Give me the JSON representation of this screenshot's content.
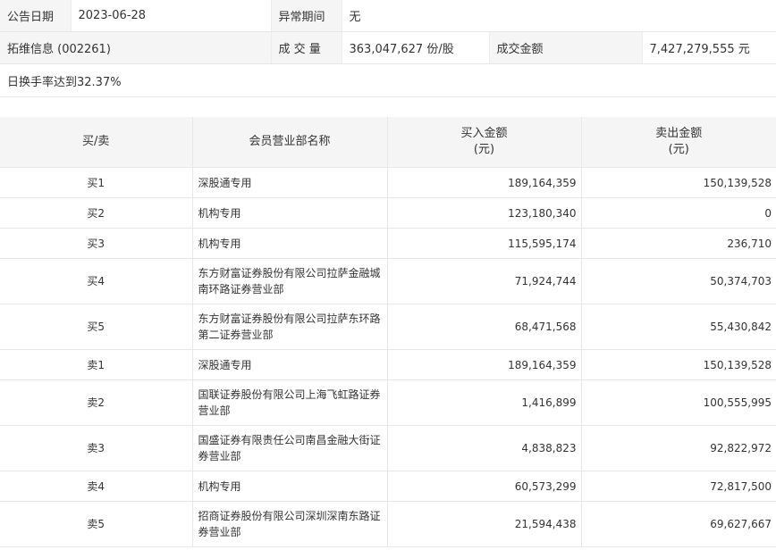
{
  "info": {
    "announce_date_label": "公告日期",
    "announce_date": "2023-06-28",
    "abnormal_period_label": "异常期间",
    "abnormal_period": "无",
    "stock": "拓维信息 (002261)",
    "volume_label": "成 交 量",
    "volume": "363,047,627 份/股",
    "amount_label": "成交金额",
    "amount": "7,427,279,555 元",
    "reason": "日换手率达到32.37%"
  },
  "table": {
    "headers": {
      "side": "买/卖",
      "dept": "会员营业部名称",
      "buy_line1": "买入金额",
      "buy_line2": "(元)",
      "sell_line1": "卖出金额",
      "sell_line2": "(元)"
    },
    "rows": [
      {
        "side": "买1",
        "name": "深股通专用",
        "buy": "189,164,359",
        "sell": "150,139,528"
      },
      {
        "side": "买2",
        "name": "机构专用",
        "buy": "123,180,340",
        "sell": "0"
      },
      {
        "side": "买3",
        "name": "机构专用",
        "buy": "115,595,174",
        "sell": "236,710"
      },
      {
        "side": "买4",
        "name": "东方财富证券股份有限公司拉萨金融城南环路证券营业部",
        "buy": "71,924,744",
        "sell": "50,374,703"
      },
      {
        "side": "买5",
        "name": "东方财富证券股份有限公司拉萨东环路第二证券营业部",
        "buy": "68,471,568",
        "sell": "55,430,842"
      },
      {
        "side": "卖1",
        "name": "深股通专用",
        "buy": "189,164,359",
        "sell": "150,139,528"
      },
      {
        "side": "卖2",
        "name": "国联证券股份有限公司上海飞虹路证券营业部",
        "buy": "1,416,899",
        "sell": "100,555,995"
      },
      {
        "side": "卖3",
        "name": "国盛证券有限责任公司南昌金融大街证券营业部",
        "buy": "4,838,823",
        "sell": "92,822,972"
      },
      {
        "side": "卖4",
        "name": "机构专用",
        "buy": "60,573,299",
        "sell": "72,817,500"
      },
      {
        "side": "卖5",
        "name": "招商证券股份有限公司深圳深南东路证券营业部",
        "buy": "21,594,438",
        "sell": "69,627,667"
      }
    ]
  }
}
